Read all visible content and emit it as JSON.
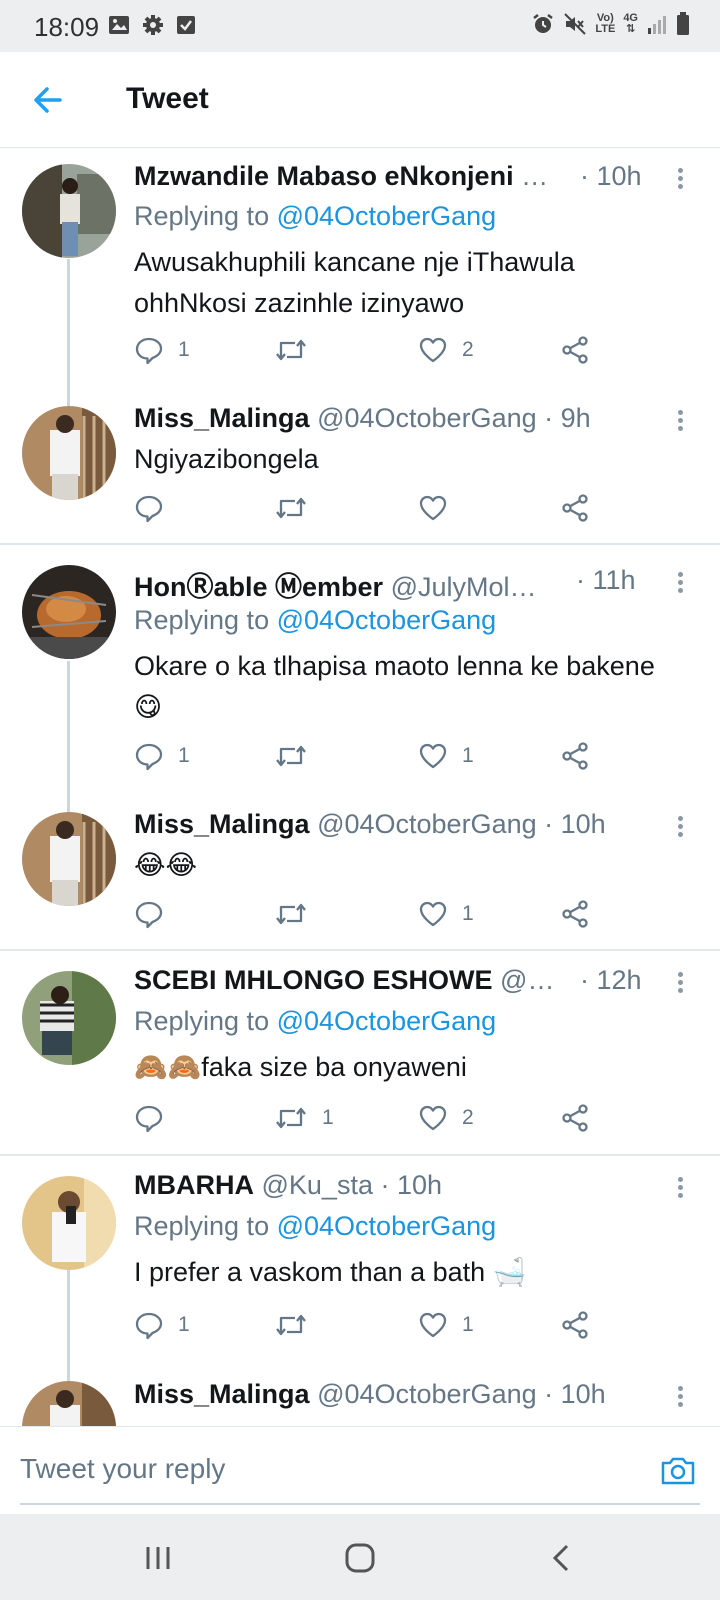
{
  "status_bar": {
    "time": "18:09",
    "volte_top": "Vo)",
    "volte_bottom": "LTE",
    "network": "4G"
  },
  "header": {
    "title": "Tweet"
  },
  "tweets": [
    {
      "name": "Mzwandile Mabaso eNkonjeni",
      "handle": "…",
      "time": "· 10h",
      "replying_label": "Replying to",
      "replying_to": "@04OctoberGang",
      "text": "Awusakhuphili kancane nje iThawula ohhNkosi zazinhle izinyawo",
      "replies": "1",
      "retweets": "",
      "likes": "2"
    },
    {
      "name": "Miss_Malinga",
      "handle": "@04OctoberGang",
      "time": "· 9h",
      "text": "Ngiyazibongela",
      "replies": "",
      "retweets": "",
      "likes": ""
    },
    {
      "name": "HonⓇable Ⓜember",
      "handle": "@JulyMol…",
      "time": "· 11h",
      "replying_label": "Replying to",
      "replying_to": "@04OctoberGang",
      "text": "Okare o ka tlhapisa maoto lenna ke bakene 😋",
      "replies": "1",
      "retweets": "",
      "likes": "1"
    },
    {
      "name": "Miss_Malinga",
      "handle": "@04OctoberGang",
      "time": "· 10h",
      "text": "😂😂",
      "replies": "",
      "retweets": "",
      "likes": "1"
    },
    {
      "name": "SCEBI MHLONGO ESHOWE",
      "handle": "@…",
      "time": "· 12h",
      "replying_label": "Replying to",
      "replying_to": "@04OctoberGang",
      "text": "🙈🙈faka size ba onyaweni",
      "replies": "",
      "retweets": "1",
      "likes": "2"
    },
    {
      "name": "MBARHA",
      "handle": "@Ku_sta",
      "time": "· 10h",
      "replying_label": "Replying to",
      "replying_to": "@04OctoberGang",
      "text": "I prefer a vaskom than a bath 🛁",
      "replies": "1",
      "retweets": "",
      "likes": "1"
    },
    {
      "name": "Miss_Malinga",
      "handle": "@04OctoberGang",
      "time": "· 10h"
    }
  ],
  "reply_box": {
    "placeholder": "Tweet your reply"
  },
  "colors": {
    "accent": "#1b95e0",
    "muted": "#657786",
    "text": "#14171a",
    "divider": "#e1e8ed"
  },
  "icons": [
    "back-arrow-icon",
    "more-icon",
    "reply-icon",
    "retweet-icon",
    "like-icon",
    "share-icon",
    "camera-icon",
    "recents-icon",
    "home-icon",
    "back-icon"
  ]
}
